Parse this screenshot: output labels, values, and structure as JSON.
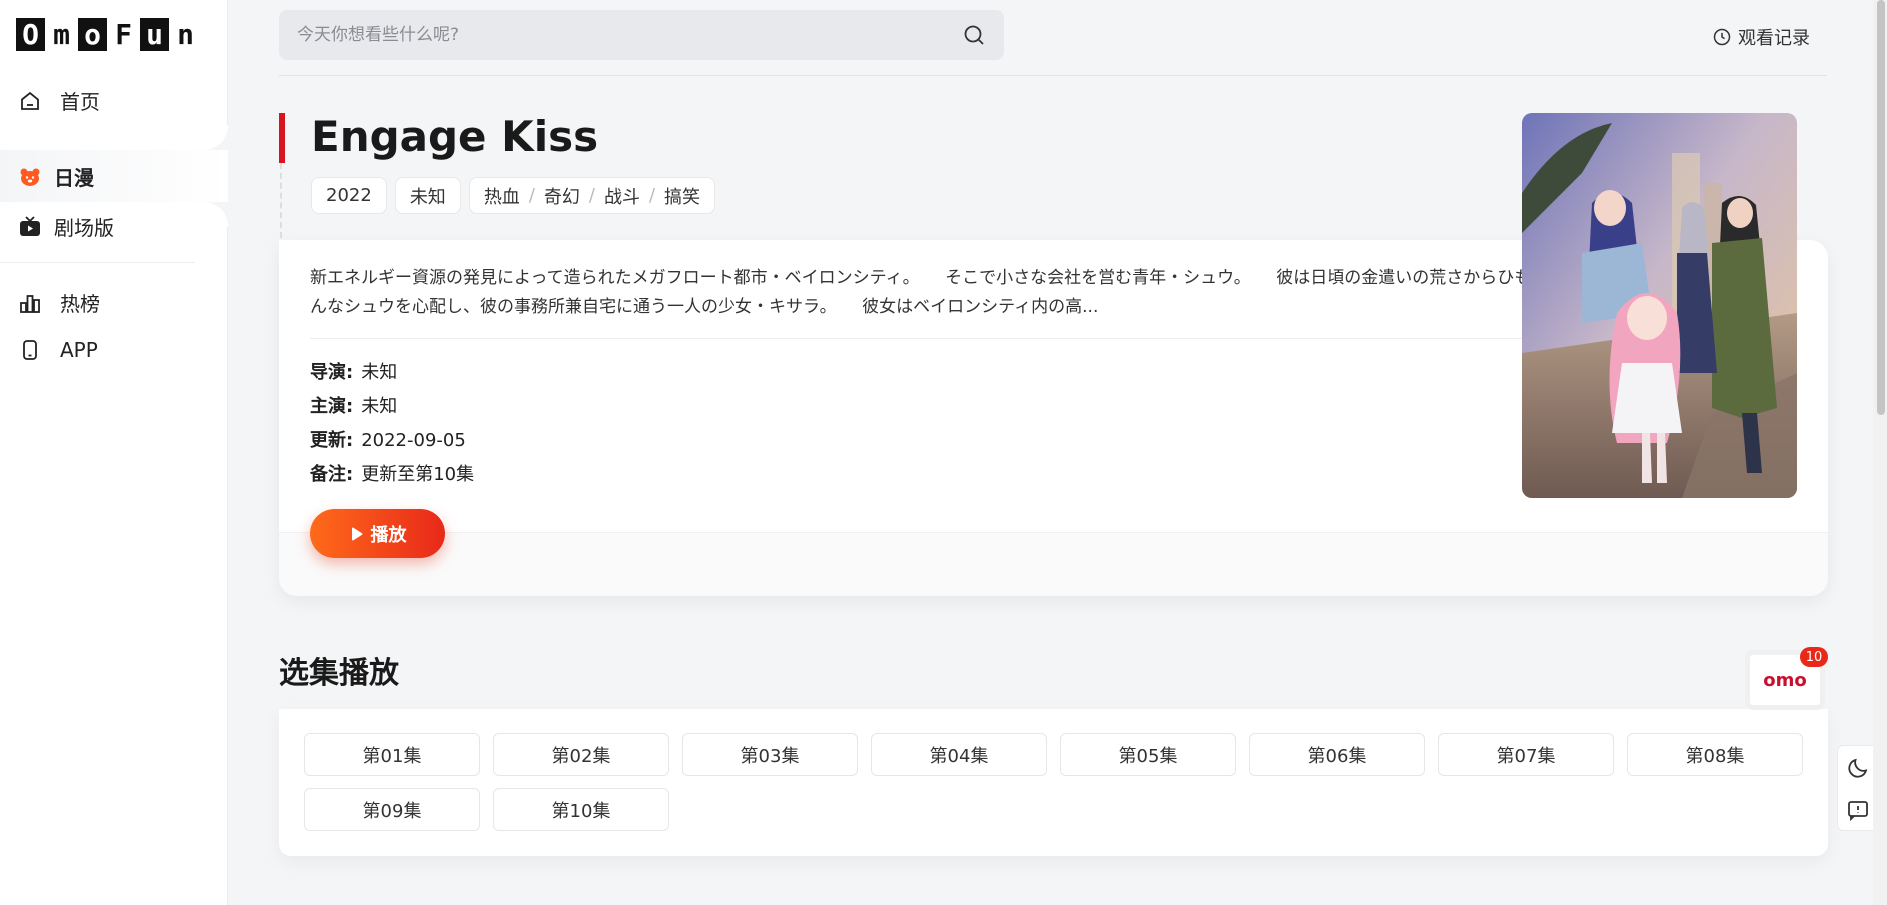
{
  "sidebar": {
    "logo_letters": [
      "O",
      "m",
      "o",
      "F",
      "u",
      "n"
    ],
    "items": [
      {
        "label": "首页",
        "icon": "home-icon"
      },
      {
        "label": "日漫",
        "icon": "bear-icon",
        "active": true
      },
      {
        "label": "剧场版",
        "icon": "tv-icon"
      },
      {
        "label": "热榜",
        "icon": "chart-icon"
      },
      {
        "label": "APP",
        "icon": "phone-icon"
      }
    ]
  },
  "header": {
    "search_placeholder": "今天你想看些什么呢?",
    "history_label": "观看记录"
  },
  "detail": {
    "title": "Engage Kiss",
    "tags": {
      "year": "2022",
      "region": "未知",
      "genres": [
        "热血",
        "奇幻",
        "战斗",
        "搞笑"
      ]
    },
    "description": "新エネルギー資源の発見によって造られたメガフロート都市・ベイロンシティ。　　そこで小さな会社を営む青年・シュウ。　　彼は日頃の金遣いの荒さからひもじい生活を送っていた。　　そんなシュウを心配し、彼の事務所兼自宅に通う一人の少女・キサラ。　　彼女はベイロンシティ内の高...",
    "info": [
      {
        "label": "导演:",
        "value": "未知"
      },
      {
        "label": "主演:",
        "value": "未知"
      },
      {
        "label": "更新:",
        "value": "2022-09-05"
      },
      {
        "label": "备注:",
        "value": "更新至第10集"
      }
    ],
    "play_label": "播放"
  },
  "episodes": {
    "title": "选集播放",
    "items": [
      "第01集",
      "第02集",
      "第03集",
      "第04集",
      "第05集",
      "第06集",
      "第07集",
      "第08集",
      "第09集",
      "第10集"
    ]
  },
  "float": {
    "omo_label": "omo",
    "omo_badge": "10"
  },
  "colors": {
    "accent": "#e8291a",
    "title_bar": "#d6151f"
  }
}
